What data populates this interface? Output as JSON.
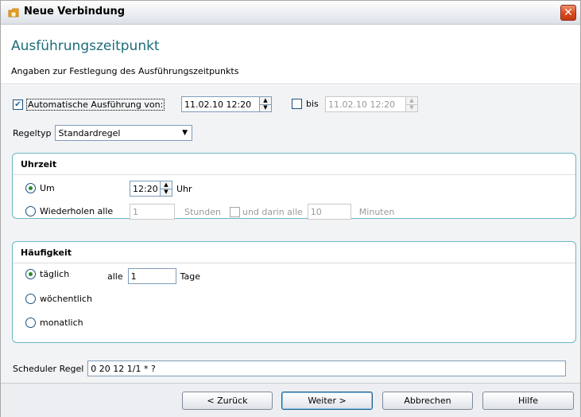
{
  "window": {
    "title": "Neue Verbindung",
    "close_symbol": "✕"
  },
  "header": {
    "title": "Ausführungszeitpunkt",
    "subtitle": "Angaben zur Festlegung des Ausführungszeitpunkts"
  },
  "auto_exec": {
    "checked": true,
    "label": "Automatische Ausführung von:",
    "from_value": "11.02.10 12:20",
    "bis_checked": false,
    "bis_label": "bis",
    "to_value": "11.02.10 12:20"
  },
  "rule_type": {
    "label": "Regeltyp",
    "selected": "Standardregel"
  },
  "time_group": {
    "title": "Uhrzeit",
    "at_label": "Um",
    "at_selected": true,
    "at_value": "12:20",
    "at_unit": "Uhr",
    "repeat_label": "Wiederholen alle",
    "repeat_selected": false,
    "repeat_value": "1",
    "repeat_unit": "Stunden",
    "within_checked": false,
    "within_label": "und darin alle",
    "within_value": "10",
    "within_unit": "Minuten"
  },
  "freq_group": {
    "title": "Häufigkeit",
    "daily_label": "täglich",
    "daily_selected": true,
    "every_label": "alle",
    "every_value": "1",
    "every_unit": "Tage",
    "weekly_label": "wöchentlich",
    "monthly_label": "monatlich"
  },
  "scheduler": {
    "label": "Scheduler Regel",
    "value": "0 20 12 1/1 * ?"
  },
  "buttons": {
    "back": "< Zurück",
    "next": "Weiter >",
    "cancel": "Abbrechen",
    "help": "Hilfe"
  },
  "colors": {
    "header_title": "#1d6d78",
    "group_border": "#6bb6c4",
    "close_button": "#d8481f",
    "radio_dot": "#2a8a2a"
  },
  "icons": {
    "app": "folder-icon",
    "close": "close-icon",
    "spinner": "spinner-icon",
    "dropdown": "chevron-down-icon"
  }
}
